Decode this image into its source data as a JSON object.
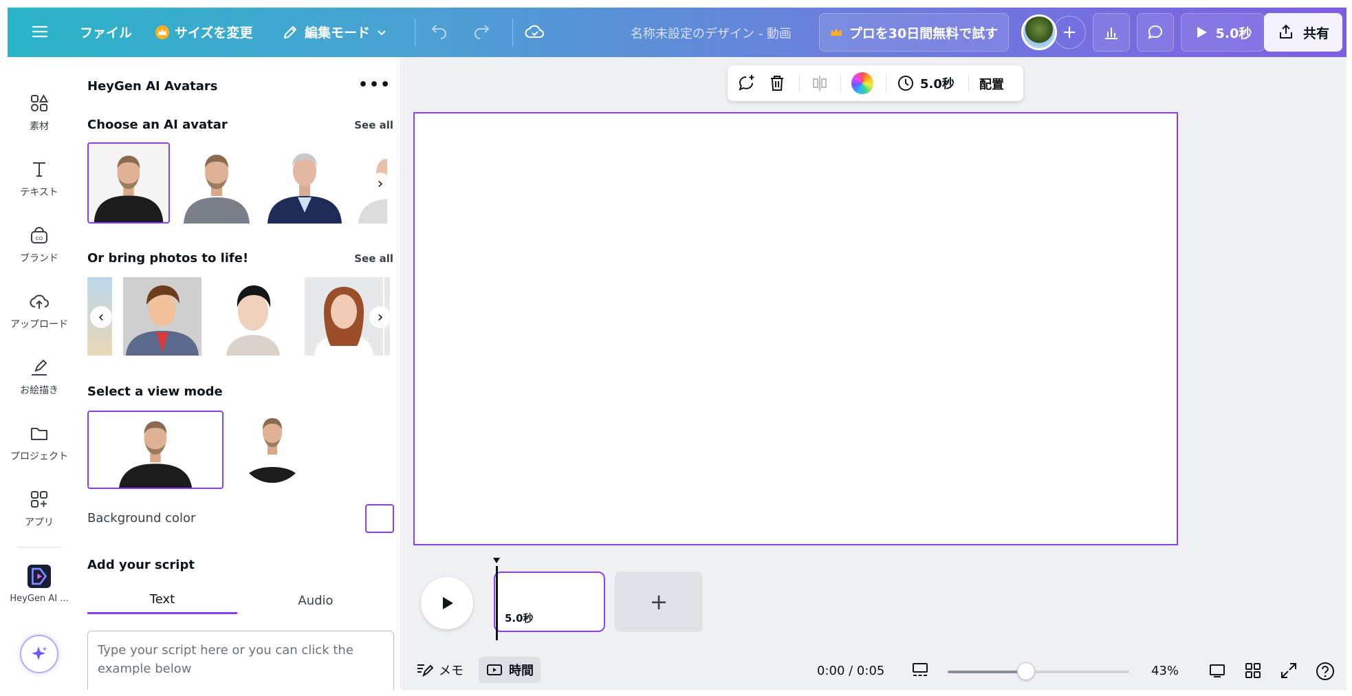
{
  "topbar": {
    "file_label": "ファイル",
    "resize_label": "サイズを変更",
    "edit_mode_label": "編集モード",
    "design_title": "名称未設定のデザイン - 動画",
    "pro_trial_label": "プロを30日間無料で試す",
    "play_duration_label": "5.0秒",
    "share_label": "共有"
  },
  "rail": {
    "items": [
      {
        "label": "素材",
        "icon": "elements-icon"
      },
      {
        "label": "テキスト",
        "icon": "text-icon"
      },
      {
        "label": "ブランド",
        "icon": "brand-icon"
      },
      {
        "label": "アップロード",
        "icon": "upload-icon"
      },
      {
        "label": "お絵描き",
        "icon": "draw-icon"
      },
      {
        "label": "プロジェクト",
        "icon": "folder-icon"
      },
      {
        "label": "アプリ",
        "icon": "apps-icon"
      },
      {
        "label": "HeyGen AI ...",
        "icon": "heygen-icon"
      }
    ]
  },
  "panel": {
    "title": "HeyGen AI Avatars",
    "choose_avatar_heading": "Choose an AI avatar",
    "see_all_label": "See all",
    "bring_photos_heading": "Or bring photos to life!",
    "see_all_label_2": "See all",
    "view_mode_heading": "Select a view mode",
    "background_color_label": "Background color",
    "script_heading": "Add your script",
    "tabs": [
      {
        "label": "Text",
        "active": true
      },
      {
        "label": "Audio",
        "active": false
      }
    ],
    "script_placeholder": "Type your script here or you can click the example below"
  },
  "canvas": {
    "ctx_duration_label": "5.0秒",
    "ctx_arrange_label": "配置",
    "clip_duration_label": "5.0秒"
  },
  "bottom": {
    "notes_label": "メモ",
    "time_label": "時間",
    "time_readout": "0:00 / 0:05",
    "zoom_label": "43%",
    "zoom_level": 0.43
  },
  "colors": {
    "accent": "#8b3dff",
    "topbar_start": "#2bb4c8",
    "topbar_end": "#7d5fe2"
  }
}
